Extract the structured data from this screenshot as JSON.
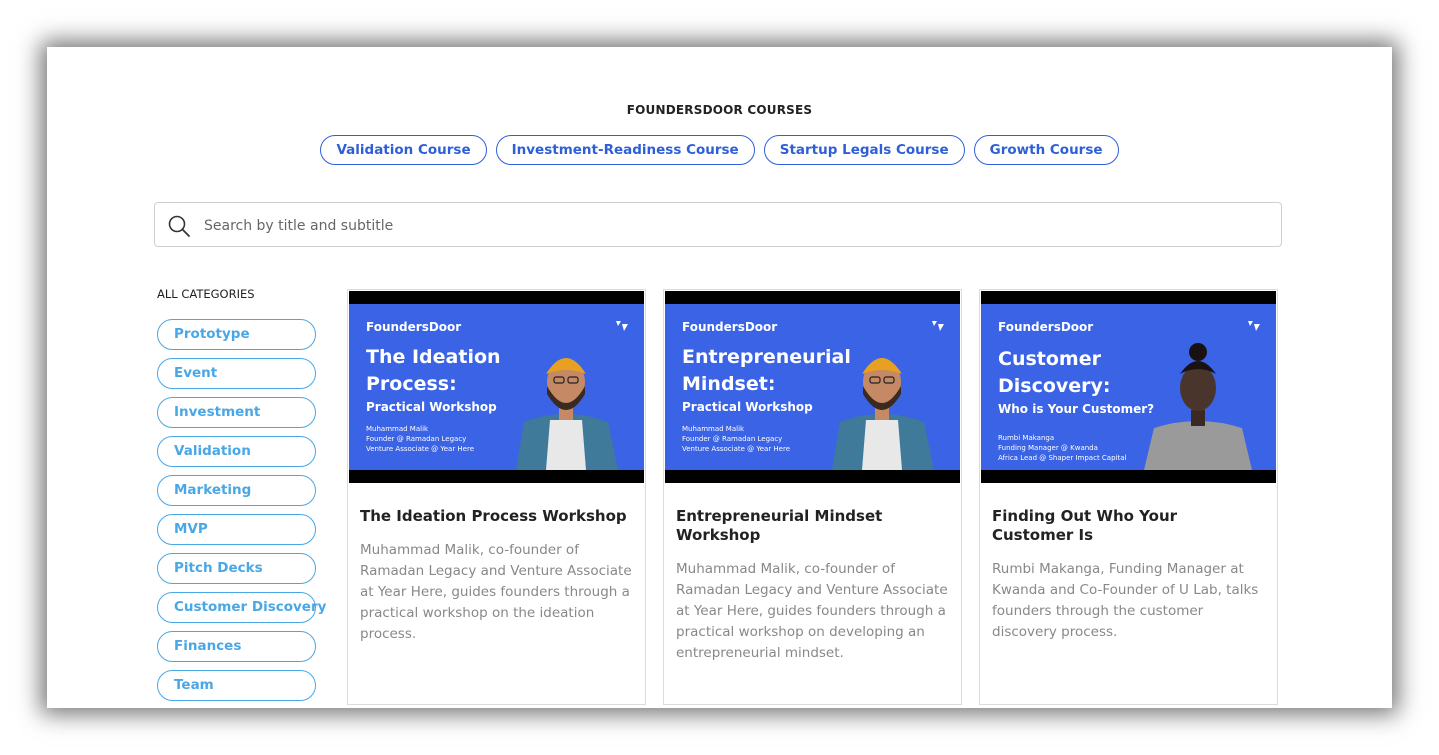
{
  "courses": {
    "heading": "FOUNDERSDOOR COURSES",
    "items": [
      "Validation Course",
      "Investment-Readiness Course",
      "Startup Legals Course",
      "Growth Course"
    ]
  },
  "search": {
    "placeholder": "Search by title and subtitle"
  },
  "categories": {
    "heading": "ALL CATEGORIES",
    "items": [
      "Prototype",
      "Event",
      "Investment",
      "Validation",
      "Marketing",
      "MVP",
      "Pitch Decks",
      "Customer Discovery",
      "Finances",
      "Team"
    ]
  },
  "colors": {
    "accent": "#2f5fd8",
    "category": "#4aa7e6",
    "thumbnail": "#3a63e6"
  },
  "cards": [
    {
      "brand": "FoundersDoor",
      "thumb_title_line1": "The Ideation",
      "thumb_title_line2": "Process:",
      "thumb_subtitle": "Practical Workshop",
      "thumb_person_1": "Muhammad Malik",
      "thumb_person_2": "Founder @ Ramadan Legacy",
      "thumb_person_3": "Venture Associate @ Year Here",
      "title": "The Ideation Process Workshop",
      "description": "Muhammad Malik, co-founder of Ramadan Legacy and Venture Associate at Year Here, guides founders through a practical workshop on the ideation process."
    },
    {
      "brand": "FoundersDoor",
      "thumb_title_line1": "Entrepreneurial",
      "thumb_title_line2": "Mindset:",
      "thumb_subtitle": "Practical Workshop",
      "thumb_person_1": "Muhammad Malik",
      "thumb_person_2": "Founder @ Ramadan Legacy",
      "thumb_person_3": "Venture Associate @ Year Here",
      "title": "Entrepreneurial Mindset Workshop",
      "description": "Muhammad Malik, co-founder of Ramadan Legacy and Venture Associate at Year Here, guides founders through a practical workshop on developing an entrepreneurial mindset."
    },
    {
      "brand": "FoundersDoor",
      "thumb_title_line1": "Customer",
      "thumb_title_line2": "Discovery:",
      "thumb_subtitle": "Who is Your Customer?",
      "thumb_person_1": "Rumbi Makanga",
      "thumb_person_2": "Funding Manager @ Kwanda",
      "thumb_person_3": "Africa Lead @ Shaper Impact Capital",
      "title": "Finding Out Who Your Customer Is",
      "description": "Rumbi Makanga, Funding Manager at Kwanda and Co-Founder of U Lab, talks founders through the customer discovery process."
    }
  ]
}
